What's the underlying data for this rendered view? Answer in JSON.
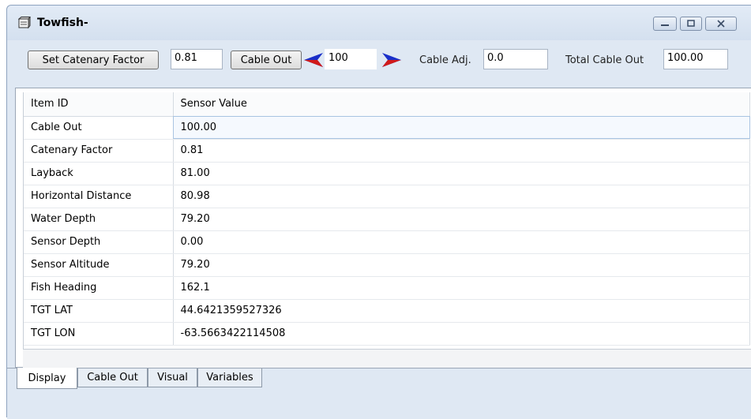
{
  "window": {
    "title": "Towfish-"
  },
  "controls": {
    "set_catenary_label": "Set Catenary Factor",
    "catenary_value": "0.81",
    "cable_out_label": "Cable Out",
    "cable_out_value": "100",
    "cable_adj_label": "Cable Adj.",
    "cable_adj_value": "0.0",
    "total_cable_out_label": "Total Cable Out",
    "total_cable_out_value": "100.00"
  },
  "grid": {
    "headers": [
      "Item ID",
      "Sensor Value"
    ],
    "rows": [
      {
        "id": "Cable Out",
        "value": "100.00"
      },
      {
        "id": "Catenary Factor",
        "value": "0.81"
      },
      {
        "id": "Layback",
        "value": "81.00"
      },
      {
        "id": "Horizontal Distance",
        "value": "80.98"
      },
      {
        "id": "Water Depth",
        "value": "79.20"
      },
      {
        "id": "Sensor Depth",
        "value": "0.00"
      },
      {
        "id": "Sensor Altitude",
        "value": "79.20"
      },
      {
        "id": "Fish Heading",
        "value": "162.1"
      },
      {
        "id": "TGT LAT",
        "value": "44.6421359527326"
      },
      {
        "id": "TGT LON",
        "value": "-63.5663422114508"
      }
    ]
  },
  "tabs": [
    {
      "label": "Display",
      "active": true
    },
    {
      "label": "Cable Out",
      "active": false
    },
    {
      "label": "Visual",
      "active": false
    },
    {
      "label": "Variables",
      "active": false
    }
  ],
  "icons": {
    "window_icon": "window-icon",
    "minimize": "minimize-icon",
    "restore": "restore-icon",
    "close": "close-icon",
    "decrease": "arrow-left-icon",
    "increase": "arrow-right-icon"
  },
  "colors": {
    "arrow_left": "#1a2fc9",
    "arrow_right": "#1a2fc9",
    "arrow_accent": "#d11a1a"
  }
}
